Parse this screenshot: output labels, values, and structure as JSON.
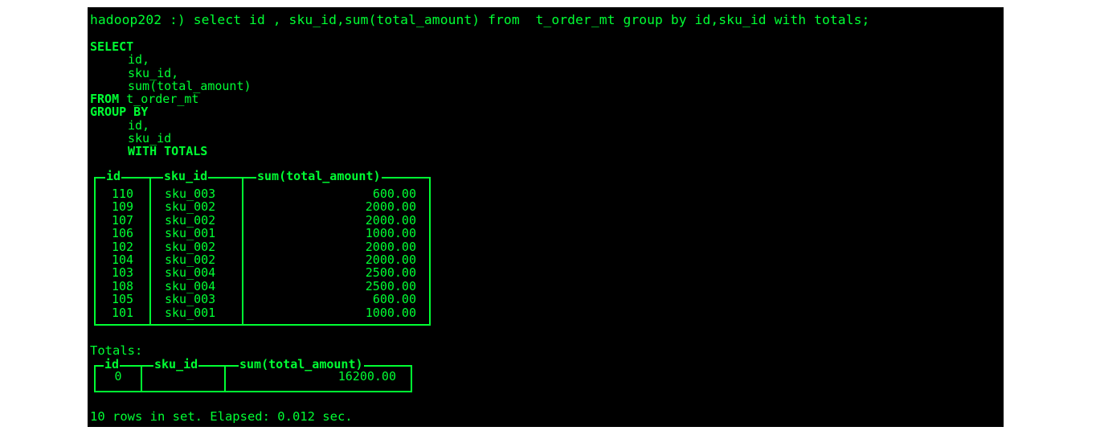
{
  "terminal": {
    "prompt_line": "hadoop202 :) select id , sku_id,sum(total_amount) from  t_order_mt group by id,sku_id with totals;",
    "formatted_query": [
      {
        "text": "SELECT",
        "kw": true,
        "indent": false
      },
      {
        "text": "id,",
        "kw": false,
        "indent": true
      },
      {
        "text": "sku_id,",
        "kw": false,
        "indent": true
      },
      {
        "text": "sum(total_amount)",
        "kw": false,
        "indent": true
      },
      {
        "text": "FROM",
        "kw": true,
        "indent": false,
        "rest": " t_order_mt"
      },
      {
        "text": "GROUP BY",
        "kw": true,
        "indent": false
      },
      {
        "text": "id,",
        "kw": false,
        "indent": true
      },
      {
        "text": "sku_id",
        "kw": false,
        "indent": true
      },
      {
        "text": "WITH TOTALS",
        "kw": true,
        "indent": true
      }
    ],
    "result": {
      "columns": [
        "id",
        "sku_id",
        "sum(total_amount)"
      ],
      "rows": [
        [
          "110",
          "sku_003",
          "600.00"
        ],
        [
          "109",
          "sku_002",
          "2000.00"
        ],
        [
          "107",
          "sku_002",
          "2000.00"
        ],
        [
          "106",
          "sku_001",
          "1000.00"
        ],
        [
          "102",
          "sku_002",
          "2000.00"
        ],
        [
          "104",
          "sku_002",
          "2000.00"
        ],
        [
          "103",
          "sku_004",
          "2500.00"
        ],
        [
          "108",
          "sku_004",
          "2500.00"
        ],
        [
          "105",
          "sku_003",
          "600.00"
        ],
        [
          "101",
          "sku_001",
          "1000.00"
        ]
      ]
    },
    "totals_label": "Totals:",
    "totals": {
      "columns": [
        "id",
        "sku_id",
        "sum(total_amount)"
      ],
      "row": [
        "0",
        "",
        "16200.00"
      ]
    },
    "footer": "10 rows in set. Elapsed: 0.012 sec.",
    "colors": {
      "background": "#000000",
      "text": "#00ff33"
    }
  }
}
